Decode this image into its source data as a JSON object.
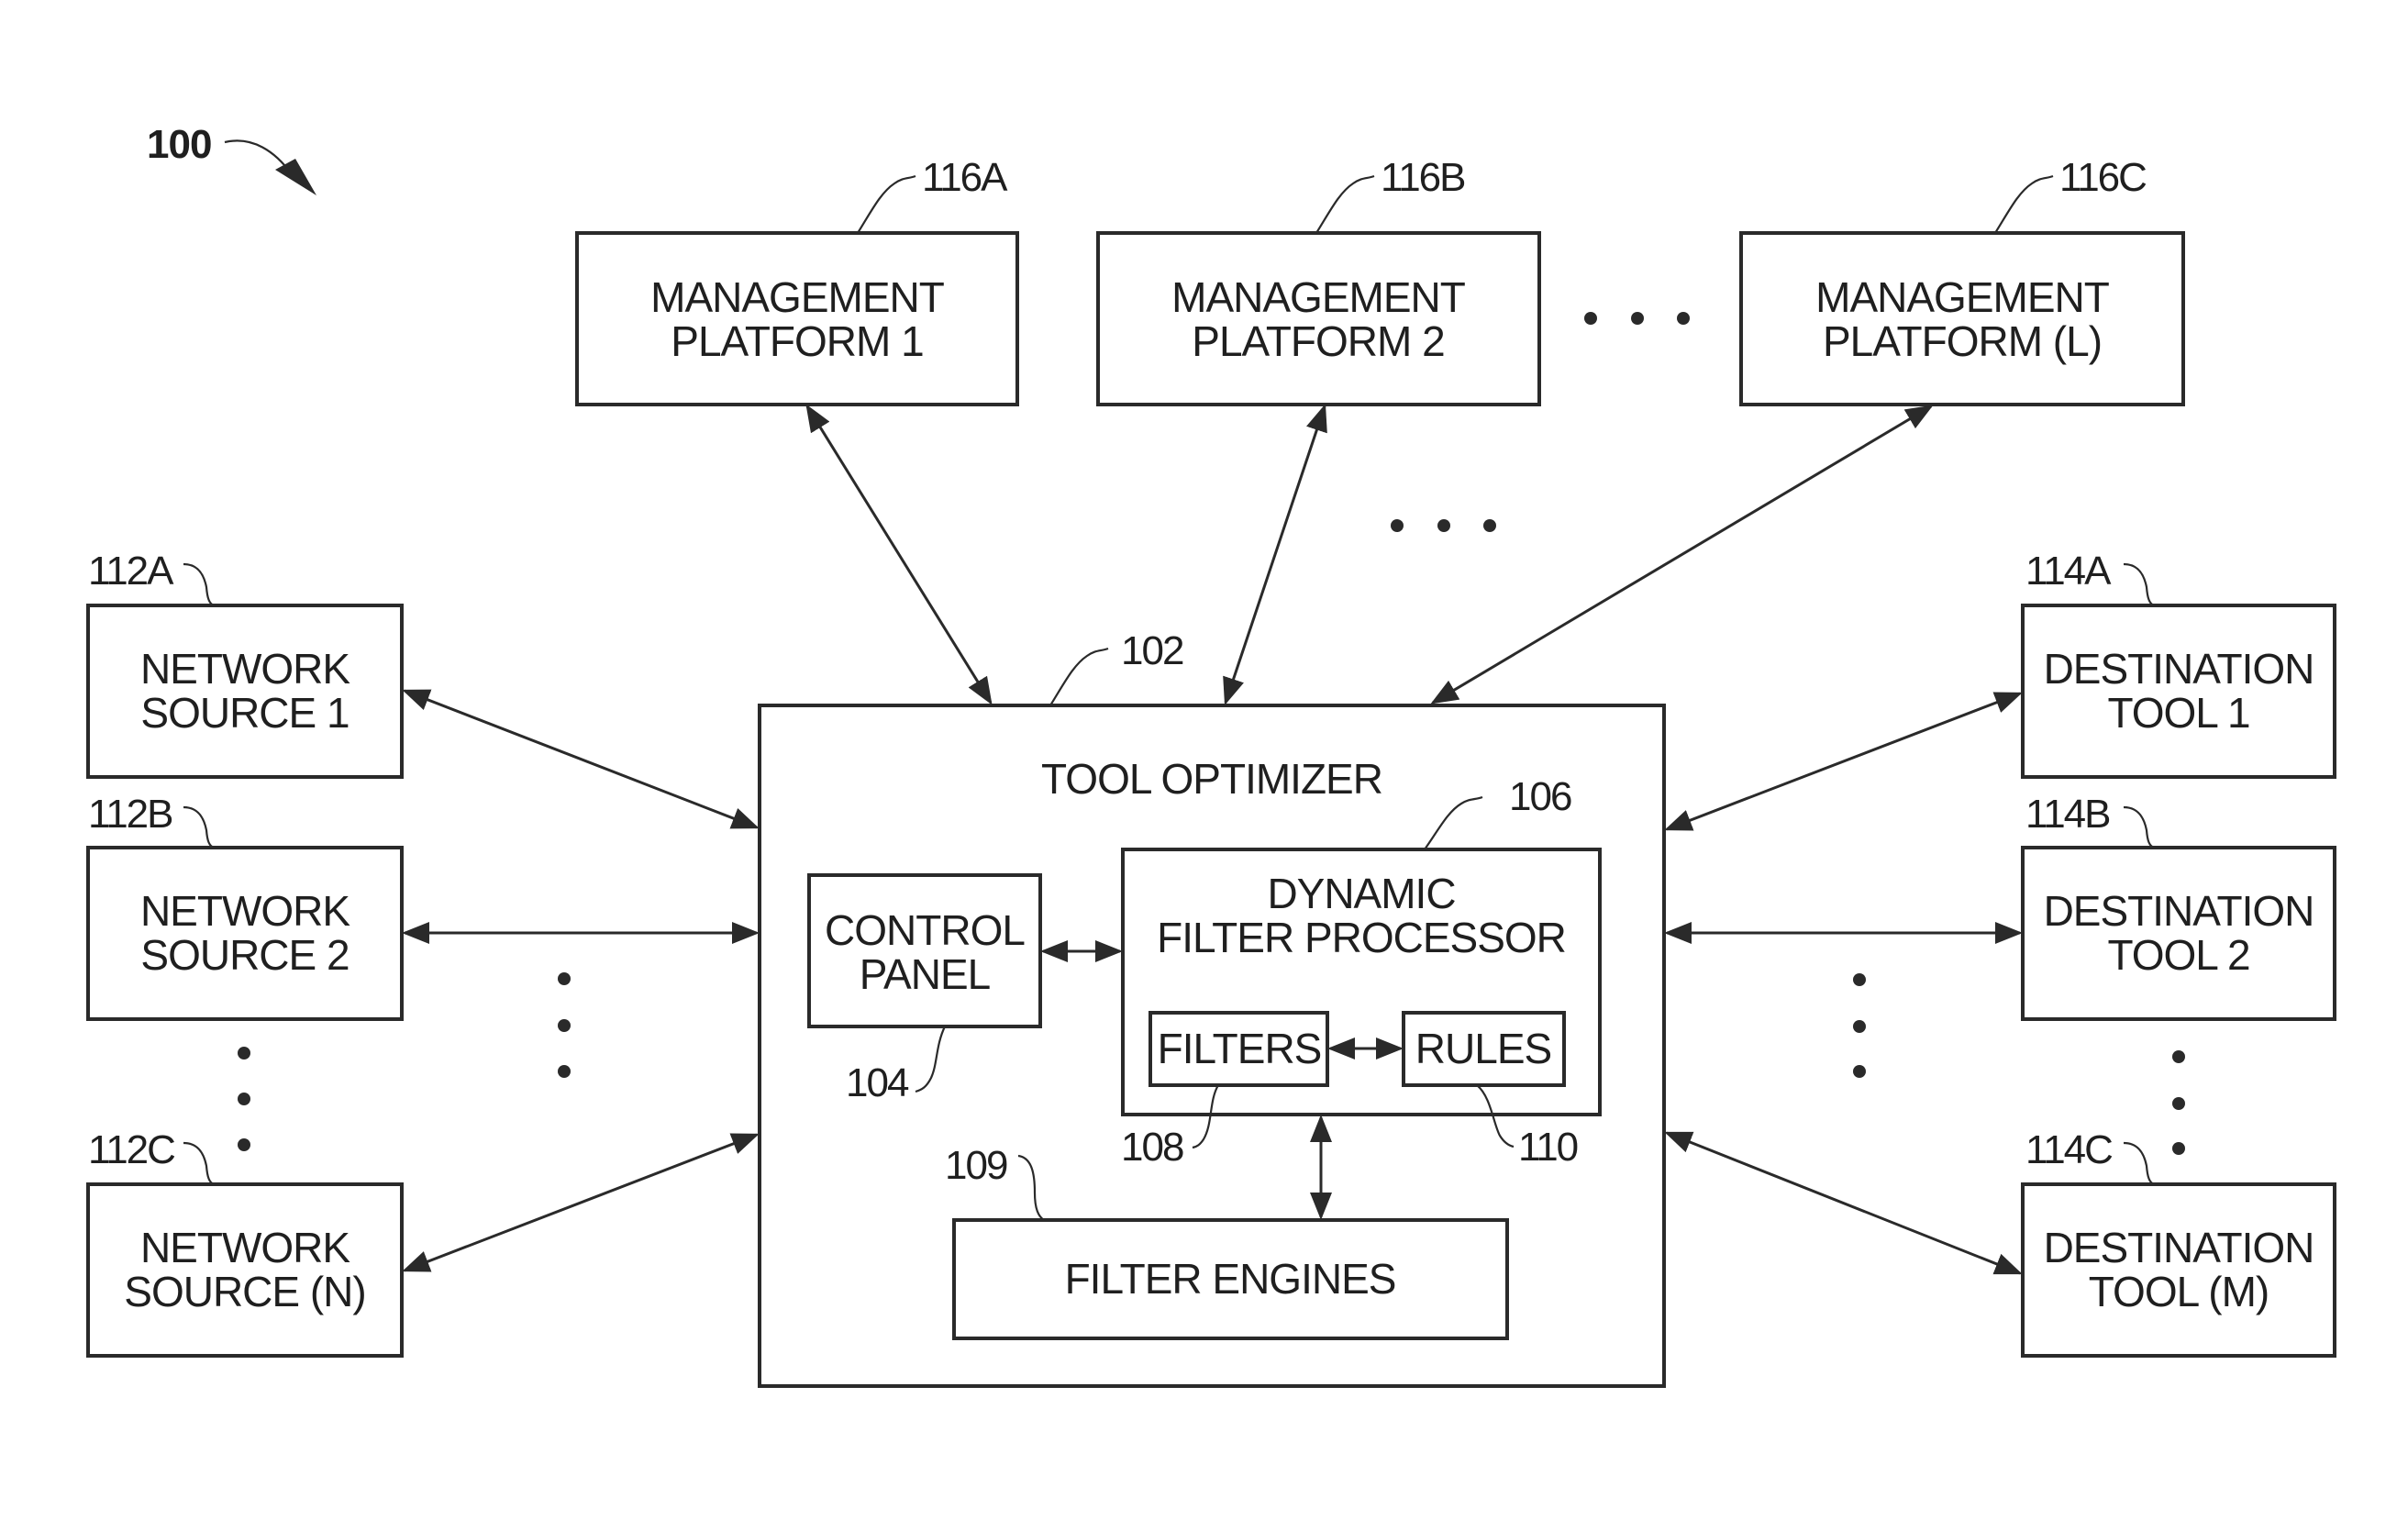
{
  "figure": {
    "ref": "100",
    "tool_optimizer": {
      "ref": "102",
      "title": "TOOL OPTIMIZER",
      "control_panel": {
        "ref": "104",
        "lines": [
          "CONTROL",
          "PANEL"
        ]
      },
      "dynamic_filter_processor": {
        "ref": "106",
        "lines": [
          "DYNAMIC",
          "FILTER PROCESSOR"
        ],
        "filters": {
          "ref": "108",
          "label": "FILTERS"
        },
        "rules": {
          "ref": "110",
          "label": "RULES"
        }
      },
      "filter_engines": {
        "ref": "109",
        "label": "FILTER ENGINES"
      }
    },
    "management_platforms": [
      {
        "ref": "116A",
        "lines": [
          "MANAGEMENT",
          "PLATFORM 1"
        ]
      },
      {
        "ref": "116B",
        "lines": [
          "MANAGEMENT",
          "PLATFORM 2"
        ]
      },
      {
        "ref": "116C",
        "lines": [
          "MANAGEMENT",
          "PLATFORM (L)"
        ]
      }
    ],
    "network_sources": [
      {
        "ref": "112A",
        "lines": [
          "NETWORK",
          "SOURCE 1"
        ]
      },
      {
        "ref": "112B",
        "lines": [
          "NETWORK",
          "SOURCE 2"
        ]
      },
      {
        "ref": "112C",
        "lines": [
          "NETWORK",
          "SOURCE (N)"
        ]
      }
    ],
    "destination_tools": [
      {
        "ref": "114A",
        "lines": [
          "DESTINATION",
          "TOOL 1"
        ]
      },
      {
        "ref": "114B",
        "lines": [
          "DESTINATION",
          "TOOL 2"
        ]
      },
      {
        "ref": "114C",
        "lines": [
          "DESTINATION",
          "TOOL (M)"
        ]
      }
    ]
  }
}
